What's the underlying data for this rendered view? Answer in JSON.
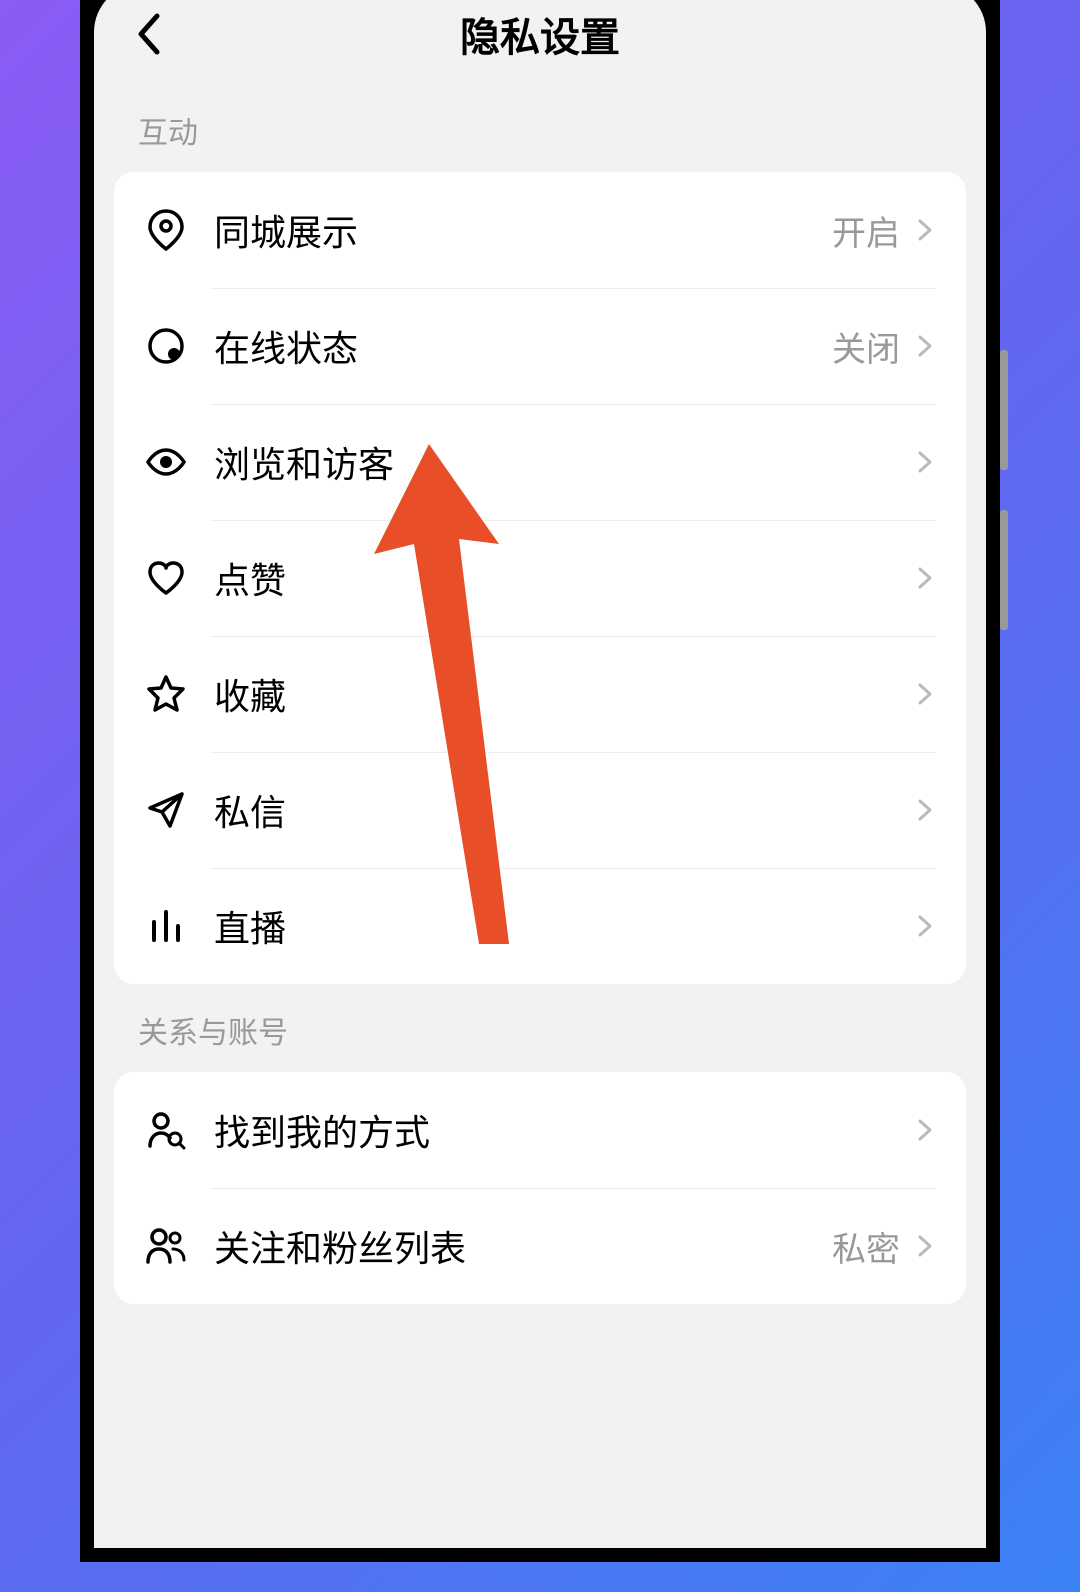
{
  "header": {
    "title": "隐私设置"
  },
  "sections": [
    {
      "label": "互动",
      "items": [
        {
          "icon": "location-icon",
          "label": "同城展示",
          "value": "开启"
        },
        {
          "icon": "status-dot-icon",
          "label": "在线状态",
          "value": "关闭"
        },
        {
          "icon": "eye-icon",
          "label": "浏览和访客",
          "value": ""
        },
        {
          "icon": "heart-icon",
          "label": "点赞",
          "value": ""
        },
        {
          "icon": "star-icon",
          "label": "收藏",
          "value": ""
        },
        {
          "icon": "send-icon",
          "label": "私信",
          "value": ""
        },
        {
          "icon": "bars-icon",
          "label": "直播",
          "value": ""
        }
      ]
    },
    {
      "label": "关系与账号",
      "items": [
        {
          "icon": "person-search-icon",
          "label": "找到我的方式",
          "value": ""
        },
        {
          "icon": "people-icon",
          "label": "关注和粉丝列表",
          "value": "私密"
        }
      ]
    }
  ]
}
